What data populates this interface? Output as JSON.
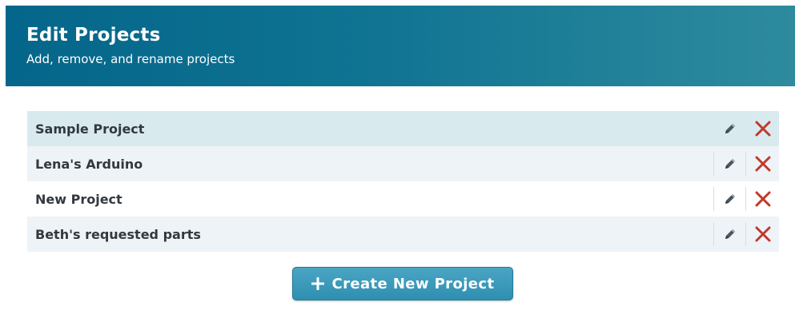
{
  "header": {
    "title": "Edit Projects",
    "subtitle": "Add, remove, and rename projects"
  },
  "projects": [
    {
      "name": "Sample Project",
      "selected": true
    },
    {
      "name": "Lena's Arduino",
      "selected": false
    },
    {
      "name": "New Project",
      "selected": false
    },
    {
      "name": "Beth's requested parts",
      "selected": false
    }
  ],
  "actions": {
    "create_label": "Create New Project",
    "create_icon": "plus-icon",
    "edit_icon": "pencil-icon",
    "delete_icon": "close-x-icon"
  },
  "colors": {
    "header_start": "#04668a",
    "header_end": "#2e8b9e",
    "selected_row": "#d9eaef",
    "alt_row": "#eef3f7",
    "delete_red": "#c0392b",
    "button_blue": "#3a9abb"
  }
}
